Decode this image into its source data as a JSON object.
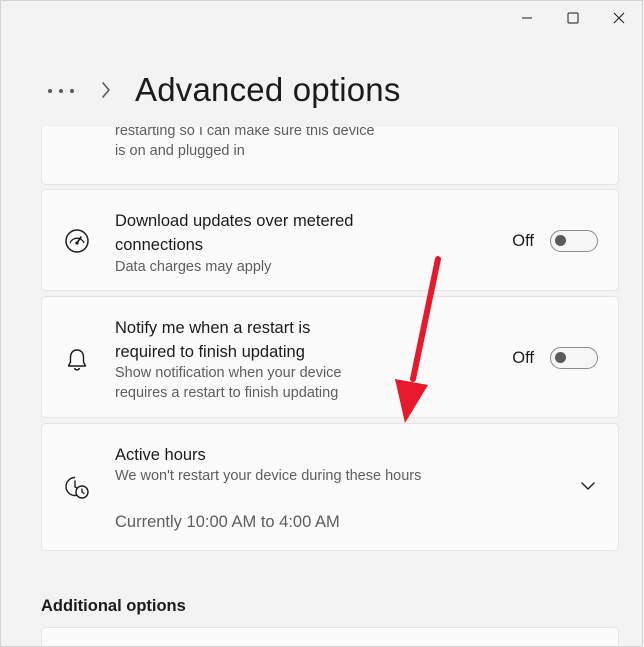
{
  "window": {
    "caption_buttons": [
      "minimize-icon",
      "maximize-icon",
      "close-icon"
    ]
  },
  "header": {
    "more_icon": "more-icon",
    "chevron_icon": "chevron-right-icon",
    "title": "Advanced options"
  },
  "cards": {
    "partial": {
      "description": "restarting so I can make sure this device is on and plugged in"
    },
    "metered": {
      "icon": "gauge-icon",
      "title_line1": "Download updates over metered",
      "title_line2": "connections",
      "subtitle": "Data charges may apply",
      "toggle_label": "Off",
      "toggle_on": false
    },
    "notify": {
      "icon": "bell-icon",
      "title_line1": "Notify me when a restart is",
      "title_line2": "required to finish updating",
      "subtitle_line1": "Show notification when your device",
      "subtitle_line2": "requires a restart to finish updating",
      "toggle_label": "Off",
      "toggle_on": false
    },
    "active_hours": {
      "icon": "clock-history-icon",
      "title": "Active hours",
      "subtitle": "We won't restart your device during these hours",
      "current": "Currently 10:00 AM to 4:00 AM",
      "chevron_icon": "chevron-down-icon"
    }
  },
  "additional": {
    "section_title": "Additional options"
  },
  "annotation": {
    "arrow_icon": "red-arrow-icon",
    "color": "#e8192c"
  }
}
